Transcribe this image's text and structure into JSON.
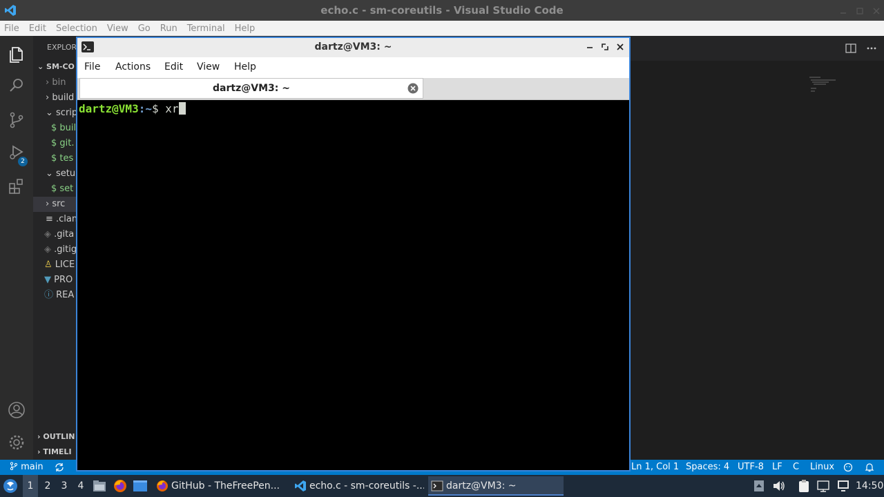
{
  "vscode": {
    "title": "echo.c - sm-coreutils - Visual Studio Code",
    "menu": [
      "File",
      "Edit",
      "Selection",
      "View",
      "Go",
      "Run",
      "Terminal",
      "Help"
    ],
    "scm_badge": "2",
    "explorer": {
      "header": "EXPLOR",
      "root": "SM-CO",
      "items": [
        {
          "label": "bin",
          "icon": "chevron-right"
        },
        {
          "label": "build",
          "icon": "chevron-right"
        },
        {
          "label": "scrip",
          "icon": "chevron-down"
        },
        {
          "label": "$ buil",
          "icon": "shell"
        },
        {
          "label": "$ git.",
          "icon": "shell"
        },
        {
          "label": "$ tes",
          "icon": "shell"
        },
        {
          "label": "setu",
          "icon": "chevron-down"
        },
        {
          "label": "$ set",
          "icon": "shell"
        },
        {
          "label": "src",
          "icon": "chevron-right"
        },
        {
          "label": ".clan",
          "icon": "lines"
        },
        {
          "label": ".gita",
          "icon": "diamond"
        },
        {
          "label": ".gitig",
          "icon": "diamond"
        },
        {
          "label": "LICE",
          "icon": "license"
        },
        {
          "label": "PRO",
          "icon": "file-blue"
        },
        {
          "label": "REA",
          "icon": "info"
        }
      ],
      "outline": "OUTLIN",
      "timeline": "TIMELI"
    },
    "status": {
      "branch": "main",
      "position": "Ln 1, Col 1",
      "spaces": "Spaces: 4",
      "encoding": "UTF-8",
      "eol": "LF",
      "language": "C",
      "platform": "Linux"
    }
  },
  "terminal": {
    "window_title": "dartz@VM3: ~",
    "menu": [
      "File",
      "Actions",
      "Edit",
      "View",
      "Help"
    ],
    "tab_title": "dartz@VM3: ~",
    "prompt_user": "dartz@VM3",
    "prompt_path": ":~",
    "prompt_symbol": "$ ",
    "command": "xr"
  },
  "taskbar": {
    "workspaces": [
      "1",
      "2",
      "3",
      "4"
    ],
    "tasks": [
      {
        "label": "GitHub - TheFreePen...",
        "icon": "firefox"
      },
      {
        "label": "echo.c - sm-coreutils -...",
        "icon": "vscode"
      },
      {
        "label": "dartz@VM3: ~",
        "icon": "terminal"
      }
    ],
    "clock": "14:50"
  }
}
